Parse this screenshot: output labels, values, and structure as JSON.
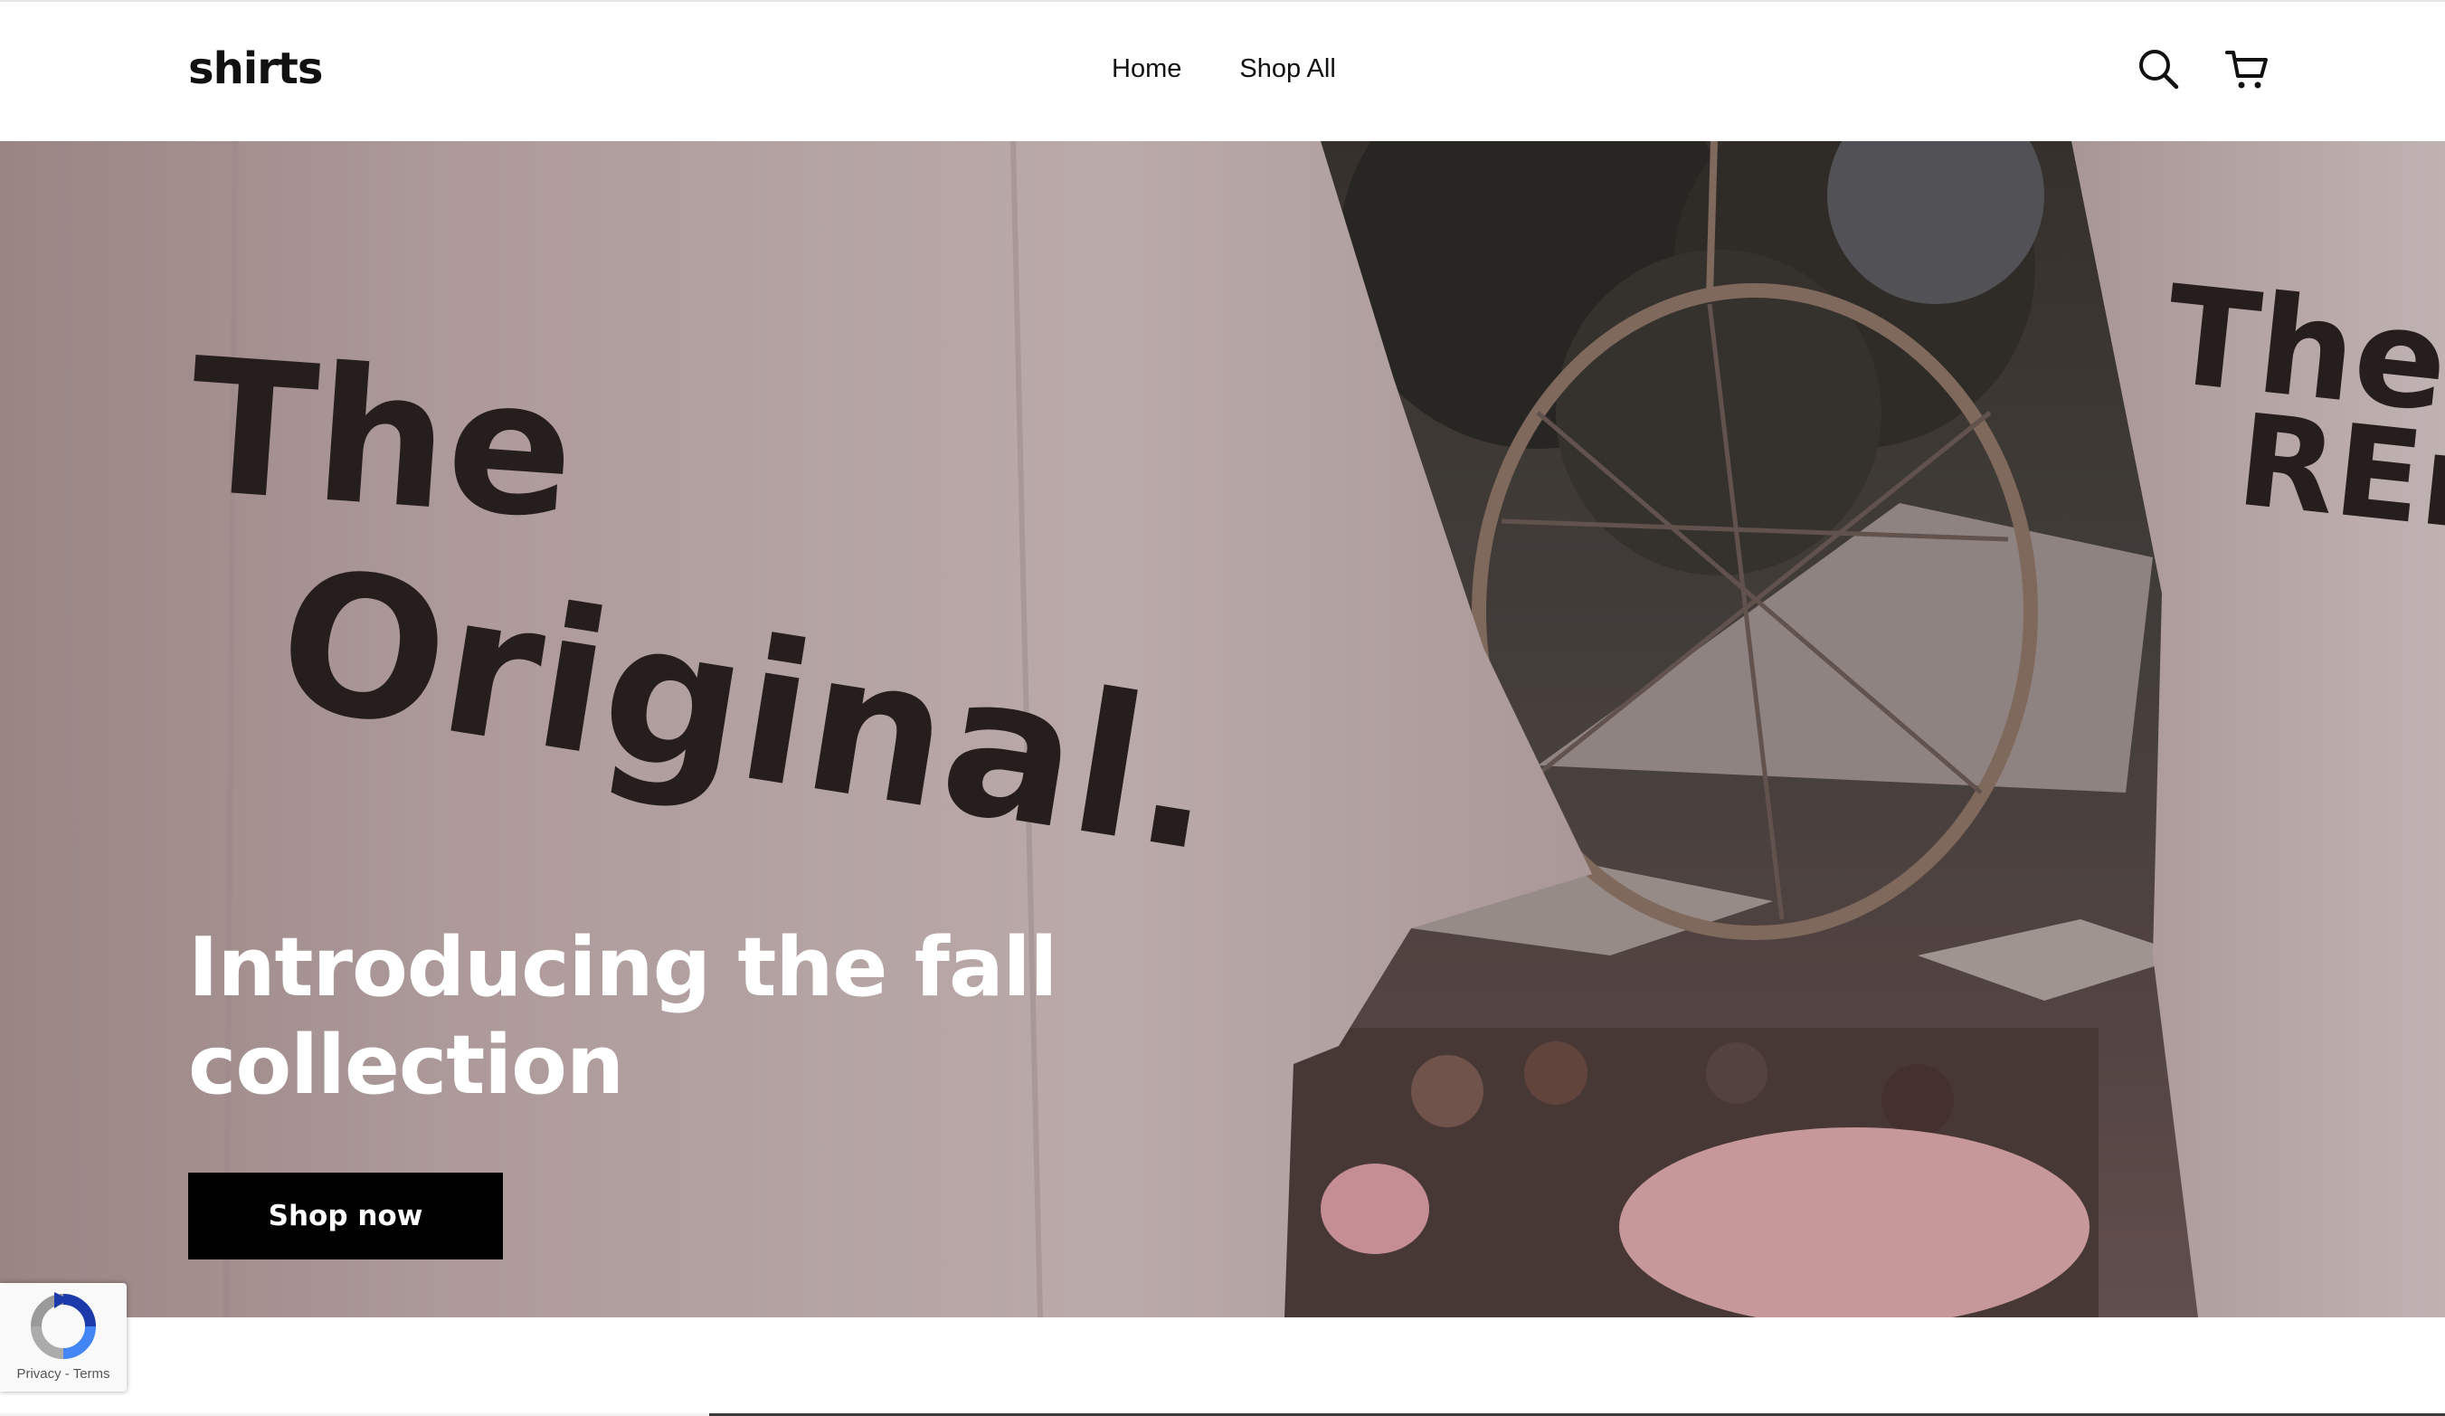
{
  "header": {
    "logo": "shirts",
    "nav": [
      {
        "label": "Home"
      },
      {
        "label": "Shop All"
      }
    ],
    "icons": [
      "search-icon",
      "cart-icon"
    ]
  },
  "hero": {
    "shirt_print_left": [
      "The",
      "Original."
    ],
    "shirt_print_right": [
      "The",
      "REm"
    ],
    "title": "Introducing the fall collection",
    "button_label": "Shop now"
  },
  "recaptcha": {
    "privacy": "Privacy",
    "separator": " - ",
    "terms": "Terms"
  },
  "colors": {
    "button_bg": "#000000",
    "hero_text": "#ffffff",
    "shirt": "#cfbcbc"
  }
}
